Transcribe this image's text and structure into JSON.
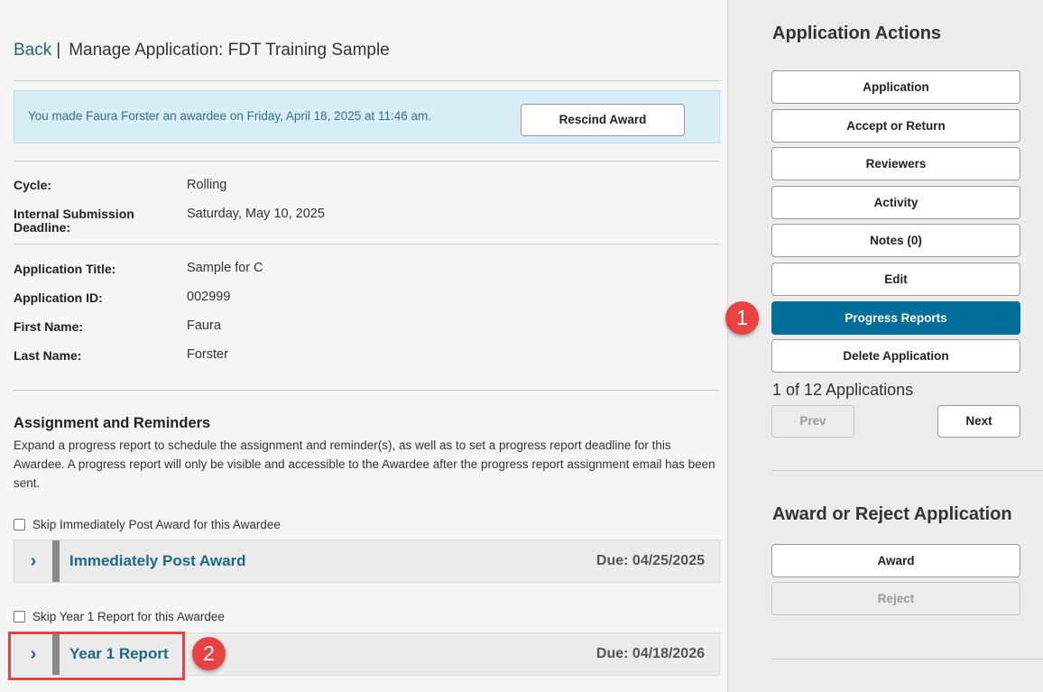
{
  "header": {
    "back": "Back",
    "separator": "|",
    "title": "Manage Application: FDT Training Sample"
  },
  "banner": {
    "text": "You made Faura Forster an awardee on Friday, April 18, 2025 at 11:46 am.",
    "button": "Rescind Award"
  },
  "cycle": {
    "label": "Cycle:",
    "value": "Rolling"
  },
  "deadline": {
    "label_line1": "Internal Submission",
    "label_line2": "Deadline:",
    "value": "Saturday, May 10, 2025"
  },
  "details": [
    {
      "label": "Application Title:",
      "value": "Sample for C"
    },
    {
      "label": "Application ID:",
      "value": "002999"
    },
    {
      "label": "First Name:",
      "value": "Faura"
    },
    {
      "label": "Last Name:",
      "value": "Forster"
    }
  ],
  "assignment": {
    "title": "Assignment and Reminders",
    "description": "Expand a progress report to schedule the assignment and reminder(s), as well as to set a progress report deadline for this Awardee. A progress report will only be visible and accessible to the Awardee after the progress report assignment email has been sent."
  },
  "reports": [
    {
      "skip_label": "Skip Immediately Post Award for this Awardee",
      "title": "Immediately Post Award",
      "due": "Due: 04/25/2025"
    },
    {
      "skip_label": "Skip Year 1 Report for this Awardee",
      "title": "Year 1 Report",
      "due": "Due: 04/18/2026"
    }
  ],
  "icons": {
    "chevron": "chevron-right-icon",
    "chevron_glyph": "›"
  },
  "callouts": [
    "1",
    "2"
  ],
  "sidebar": {
    "actions_title": "Application Actions",
    "actions": [
      "Application",
      "Accept or Return",
      "Reviewers",
      "Activity",
      "Notes (0)",
      "Edit",
      "Progress Reports",
      "Delete Application"
    ],
    "active_action": "Progress Reports",
    "count_text": "1 of 12 Applications",
    "prev": "Prev",
    "next": "Next",
    "award_title": "Award or Reject Application",
    "award": "Award",
    "reject": "Reject"
  },
  "colors": {
    "accent": "#006e9a",
    "link": "#1a6a86",
    "callout": "#e84342",
    "banner_bg": "#d9edf7"
  }
}
